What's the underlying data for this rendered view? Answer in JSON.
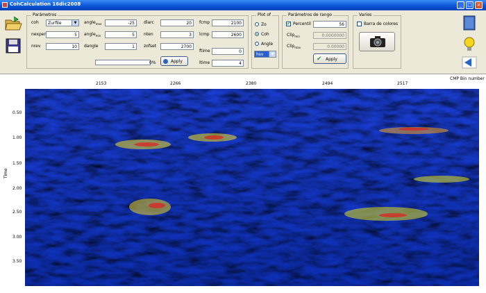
{
  "window": {
    "title": "CohCalculation 16dic2008"
  },
  "params": {
    "group_label": "Parámetros",
    "rows": [
      {
        "label": "coh",
        "value": "Zurfile"
      },
      {
        "label": "nexpert",
        "value": "5"
      },
      {
        "label": "nrev",
        "value": "10"
      }
    ],
    "angles": [
      {
        "label": "angle",
        "sub": "max",
        "value": "-25"
      },
      {
        "label": "angle",
        "sub": "min",
        "value": "5"
      },
      {
        "label": "dangle",
        "sub": "",
        "value": "1"
      }
    ],
    "fields": [
      {
        "label": "dlarc",
        "value": "20"
      },
      {
        "label": "nten",
        "value": "3"
      },
      {
        "label": "zofset",
        "value": "2700"
      }
    ],
    "ranges": [
      {
        "label": "fcmp",
        "value": "2100"
      },
      {
        "label": "lcmp",
        "value": "2600"
      },
      {
        "label": "ftime",
        "value": "0"
      },
      {
        "label": "ltime",
        "value": "4"
      }
    ],
    "progress_label": "0%",
    "apply": "Apply"
  },
  "plot": {
    "group_label": "Plot of",
    "options": [
      "Zo",
      "Coh",
      "Angle"
    ],
    "selected": "Coh",
    "select_value": "hsv"
  },
  "range": {
    "group_label": "Parámetros de rango",
    "percentil_label": "Percentil",
    "percentil_value": "56",
    "clip_min_label": "Clip",
    "clip_min_sub": "min",
    "clip_min_value": "0.0000000",
    "clip_max_label": "Clip",
    "clip_max_sub": "max",
    "clip_max_value": "0.00000",
    "apply": "Apply"
  },
  "varios": {
    "group_label": "Varios",
    "barra_label": "Barra de colores"
  },
  "axis": {
    "x_label": "CMP Bin number",
    "y_label": "Time",
    "x_ticks": [
      "2153",
      "2266",
      "2380",
      "2494",
      "2517"
    ],
    "y_ticks": [
      "0.50",
      "1.00",
      "1.50",
      "2.00",
      "2.50",
      "3.00",
      "3.50"
    ]
  },
  "icons": [
    "folder-open-icon",
    "floppy-save-icon",
    "camera-icon",
    "book-icon",
    "lightbulb-icon",
    "back-arrow-icon"
  ]
}
